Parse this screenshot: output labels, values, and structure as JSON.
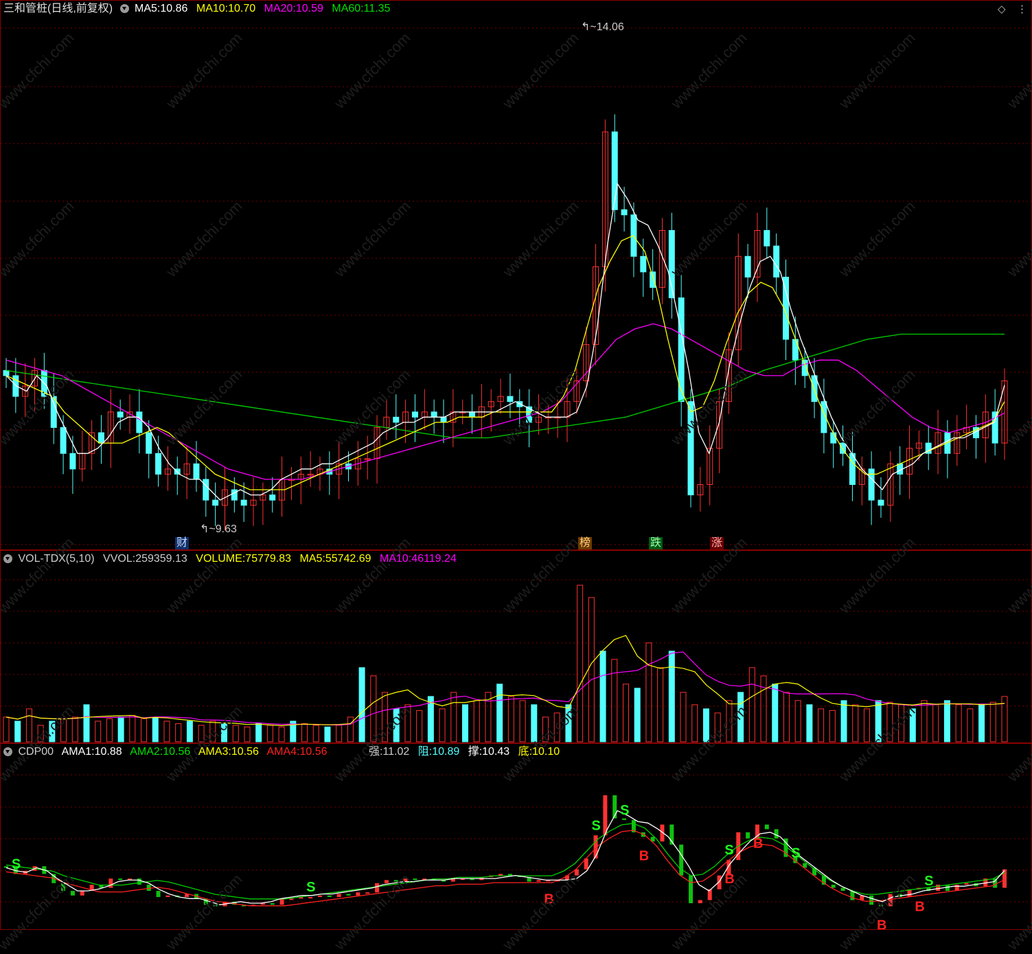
{
  "price_panel": {
    "stock_title": "三和管桩(日线,前复权)",
    "ma5_label": "MA5:",
    "ma5_value": "10.86",
    "ma10_label": "MA10:",
    "ma10_value": "10.70",
    "ma20_label": "MA20:",
    "ma20_value": "10.59",
    "ma60_label": "MA60:",
    "ma60_value": "11.35",
    "high_marker": "14.06",
    "low_marker": "9.63",
    "event_tags": [
      "财",
      "榜",
      "跌",
      "涨"
    ],
    "corner_icons": [
      "diamond-icon",
      "more-icon"
    ]
  },
  "volume_panel": {
    "indicator": "VOL-TDX(5,10)",
    "vvol_label": "VVOL:",
    "vvol_value": "259359.13",
    "volume_label": "VOLUME:",
    "volume_value": "75779.83",
    "ma5_label": "MA5:",
    "ma5_value": "55742.69",
    "ma10_label": "MA10:",
    "ma10_value": "46119.24"
  },
  "cdp_panel": {
    "indicator": "CDP00",
    "ama1_label": "AMA1:",
    "ama1_value": "10.88",
    "ama2_label": "AMA2:",
    "ama2_value": "10.56",
    "ama3_label": "AMA3:",
    "ama3_value": "10.56",
    "ama4_label": "AMA4:",
    "ama4_value": "10.56",
    "strong_label": "强:",
    "strong_value": "11.02",
    "resist_label": "阻:",
    "resist_value": "10.89",
    "support_label": "撑:",
    "support_value": "10.43",
    "bottom_label": "底:",
    "bottom_value": "10.10",
    "signal_sell": "S",
    "signal_buy": "B"
  },
  "watermark": "www.cfchi.com",
  "colors": {
    "up": "#ff3232",
    "down": "#54ffff",
    "ma5": "#ffffff",
    "ma10": "#ffff00",
    "ma20": "#ff00ff",
    "ma60": "#00d000",
    "grid": "#7a0000",
    "border": "#8b0000"
  },
  "chart_data": {
    "type": "candlestick",
    "ylabel": "",
    "close": [
      10.95,
      10.75,
      10.85,
      11.0,
      10.75,
      10.45,
      10.2,
      10.05,
      10.2,
      10.4,
      10.3,
      10.6,
      10.55,
      10.6,
      10.4,
      10.2,
      10.0,
      10.05,
      10.0,
      10.1,
      9.95,
      9.75,
      9.7,
      9.85,
      9.75,
      9.7,
      9.75,
      9.8,
      9.75,
      9.95,
      9.95,
      10.0,
      10.0,
      10.05,
      10.0,
      10.1,
      10.05,
      10.15,
      10.15,
      10.45,
      10.55,
      10.5,
      10.6,
      10.55,
      10.6,
      10.55,
      10.5,
      10.6,
      10.6,
      10.55,
      10.65,
      10.7,
      10.75,
      10.7,
      10.65,
      10.5,
      10.55,
      10.55,
      10.55,
      10.7,
      10.9,
      11.25,
      12.0,
      13.3,
      12.55,
      12.5,
      12.1,
      11.95,
      11.8,
      12.35,
      11.7,
      10.7,
      9.8,
      9.9,
      10.25,
      10.7,
      11.2,
      12.1,
      11.9,
      12.35,
      12.2,
      11.9,
      11.3,
      11.1,
      10.95,
      10.7,
      10.4,
      10.3,
      10.2,
      9.9,
      10.05,
      9.75,
      9.7,
      10.1,
      10.0,
      10.25,
      10.3,
      10.2,
      10.4,
      10.2,
      10.4,
      10.45,
      10.35,
      10.6,
      10.3,
      10.9
    ],
    "ma5": [
      10.95,
      10.85,
      10.8,
      10.95,
      10.85,
      10.6,
      10.4,
      10.2,
      10.2,
      10.25,
      10.35,
      10.5,
      10.55,
      10.55,
      10.45,
      10.25,
      10.1,
      10.0,
      9.95,
      9.95,
      9.85,
      9.75,
      9.8,
      9.85,
      9.8,
      9.8,
      9.85,
      9.95,
      10.0,
      10.05,
      10.05,
      10.1,
      10.1,
      10.15,
      10.2,
      10.25,
      10.3,
      10.4,
      10.45,
      10.5,
      10.5,
      10.55,
      10.55,
      10.55,
      10.6,
      10.6,
      10.6,
      10.6,
      10.6,
      10.65,
      10.7,
      10.65,
      10.6,
      10.55,
      10.55,
      10.55,
      10.6,
      10.85,
      11.4,
      12.2,
      12.8,
      12.65,
      12.45,
      12.4,
      12.2,
      11.95,
      11.5,
      11.0,
      10.4,
      10.2,
      10.5,
      11.05,
      11.45,
      11.8,
      12.05,
      12.1,
      11.95,
      11.6,
      11.3,
      11.05,
      10.8,
      10.55,
      10.35,
      10.2,
      10.05,
      9.95,
      9.85,
      10.0,
      10.05,
      10.1,
      10.2,
      10.25,
      10.3,
      10.35,
      10.35,
      10.4,
      10.45,
      10.5,
      10.86
    ],
    "ma10": [
      10.95,
      10.9,
      10.85,
      10.8,
      10.75,
      10.6,
      10.5,
      10.4,
      10.3,
      10.3,
      10.3,
      10.35,
      10.4,
      10.45,
      10.4,
      10.3,
      10.2,
      10.1,
      10.0,
      9.95,
      9.9,
      9.85,
      9.85,
      9.85,
      9.85,
      9.9,
      9.95,
      10.0,
      10.05,
      10.1,
      10.15,
      10.2,
      10.25,
      10.3,
      10.35,
      10.4,
      10.45,
      10.5,
      10.5,
      10.55,
      10.55,
      10.55,
      10.6,
      10.6,
      10.6,
      10.6,
      10.6,
      10.6,
      10.75,
      11.0,
      11.4,
      11.8,
      12.05,
      12.25,
      12.3,
      12.15,
      11.8,
      11.3,
      10.85,
      10.6,
      10.65,
      10.9,
      11.25,
      11.55,
      11.75,
      11.85,
      11.8,
      11.6,
      11.3,
      11.0,
      10.7,
      10.45,
      10.25,
      10.1,
      10.0,
      10.0,
      10.05,
      10.1,
      10.15,
      10.2,
      10.25,
      10.3,
      10.35,
      10.4,
      10.45,
      10.5,
      10.7
    ],
    "ma20": [
      11.1,
      11.05,
      11.0,
      10.95,
      10.85,
      10.75,
      10.65,
      10.55,
      10.45,
      10.35,
      10.25,
      10.15,
      10.05,
      10.0,
      9.95,
      9.95,
      9.95,
      10.0,
      10.05,
      10.1,
      10.15,
      10.2,
      10.25,
      10.3,
      10.35,
      10.4,
      10.45,
      10.5,
      10.55,
      10.6,
      10.7,
      10.9,
      11.1,
      11.3,
      11.4,
      11.45,
      11.4,
      11.3,
      11.2,
      11.1,
      11.0,
      10.95,
      10.95,
      11.05,
      11.1,
      11.1,
      11.0,
      10.85,
      10.7,
      10.55,
      10.45,
      10.4,
      10.45,
      10.5,
      10.59
    ],
    "ma60": [
      11.0,
      10.95,
      10.9,
      10.85,
      10.8,
      10.75,
      10.7,
      10.65,
      10.6,
      10.55,
      10.5,
      10.45,
      10.4,
      10.35,
      10.35,
      10.4,
      10.45,
      10.5,
      10.55,
      10.65,
      10.75,
      10.85,
      11.0,
      11.1,
      11.2,
      11.3,
      11.35,
      11.35,
      11.35,
      11.35
    ],
    "volume": [
      30,
      25,
      40,
      20,
      25,
      28,
      30,
      45,
      25,
      28,
      30,
      32,
      28,
      30,
      25,
      22,
      25,
      20,
      25,
      22,
      20,
      18,
      22,
      20,
      18,
      25,
      22,
      20,
      18,
      20,
      30,
      90,
      80,
      60,
      40,
      45,
      38,
      55,
      40,
      60,
      45,
      50,
      60,
      70,
      55,
      50,
      45,
      30,
      35,
      45,
      190,
      175,
      110,
      100,
      70,
      65,
      120,
      90,
      110,
      60,
      45,
      40,
      35,
      50,
      60,
      90,
      80,
      70,
      60,
      50,
      45,
      40,
      38,
      50,
      45,
      40,
      50,
      48,
      45,
      40,
      50,
      45,
      50,
      45,
      40,
      45,
      48,
      55
    ]
  }
}
